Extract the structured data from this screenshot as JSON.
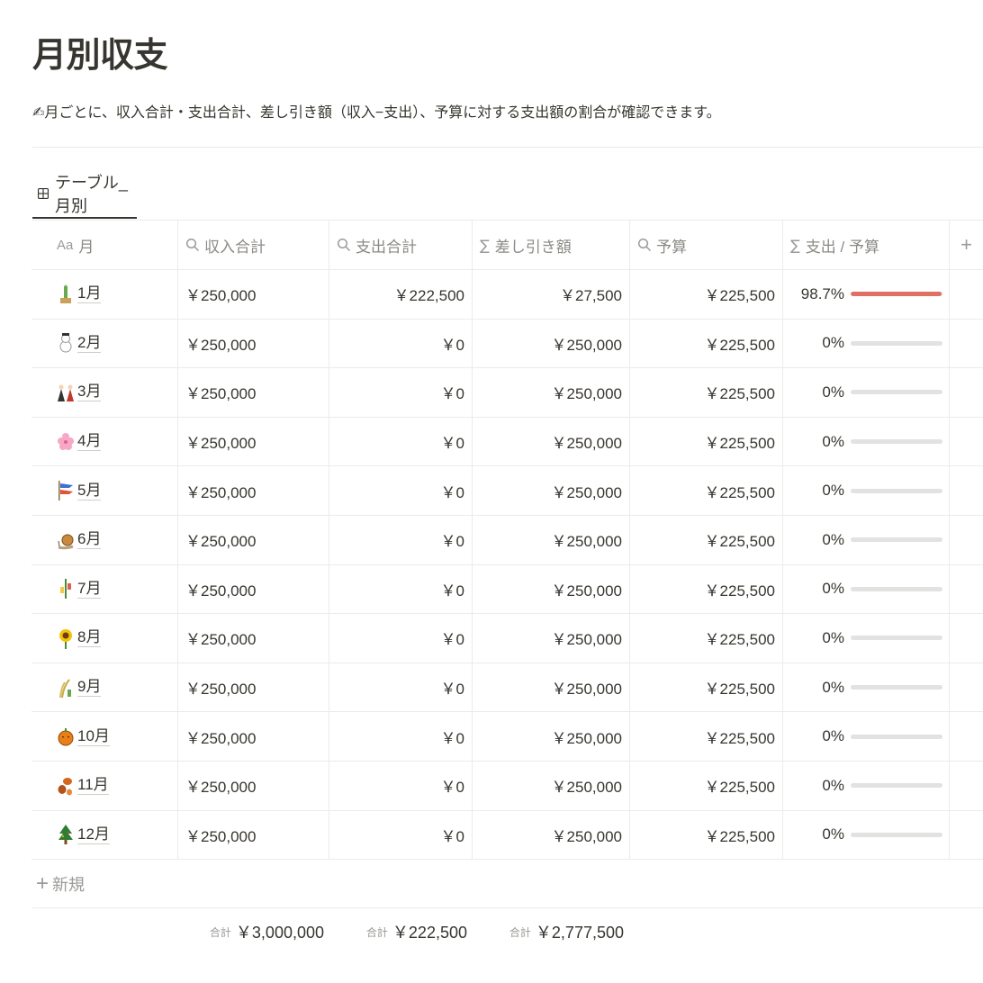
{
  "page": {
    "title": "月別収支",
    "description": "月ごとに、収入合計・支出合計、差し引き額（収入−支出）、予算に対する支出額の割合が確認できます。",
    "description_icon": "writing-hand-icon"
  },
  "view": {
    "tab_label": "テーブル_月別",
    "tab_icon": "table-icon"
  },
  "columns": [
    {
      "label": "月",
      "icon": "title-aa-icon"
    },
    {
      "label": "収入合計",
      "icon": "search-icon"
    },
    {
      "label": "支出合計",
      "icon": "search-icon"
    },
    {
      "label": "差し引き額",
      "icon": "sigma-icon"
    },
    {
      "label": "予算",
      "icon": "search-icon"
    },
    {
      "label": "支出 / 予算",
      "icon": "sigma-icon"
    }
  ],
  "add_column_label": "+",
  "rows": [
    {
      "month": "1月",
      "icon": "kadomatsu-icon",
      "income": "￥250,000",
      "expense": "￥222,500",
      "diff": "￥27,500",
      "budget": "￥225,500",
      "ratio_text": "98.7%",
      "ratio": 0.987
    },
    {
      "month": "2月",
      "icon": "snowman-icon",
      "income": "￥250,000",
      "expense": "￥0",
      "diff": "￥250,000",
      "budget": "￥225,500",
      "ratio_text": "0%",
      "ratio": 0
    },
    {
      "month": "3月",
      "icon": "hina-dolls-icon",
      "income": "￥250,000",
      "expense": "￥0",
      "diff": "￥250,000",
      "budget": "￥225,500",
      "ratio_text": "0%",
      "ratio": 0
    },
    {
      "month": "4月",
      "icon": "cherry-blossom-icon",
      "income": "￥250,000",
      "expense": "￥0",
      "diff": "￥250,000",
      "budget": "￥225,500",
      "ratio_text": "0%",
      "ratio": 0
    },
    {
      "month": "5月",
      "icon": "carp-streamer-icon",
      "income": "￥250,000",
      "expense": "￥0",
      "diff": "￥250,000",
      "budget": "￥225,500",
      "ratio_text": "0%",
      "ratio": 0
    },
    {
      "month": "6月",
      "icon": "snail-icon",
      "income": "￥250,000",
      "expense": "￥0",
      "diff": "￥250,000",
      "budget": "￥225,500",
      "ratio_text": "0%",
      "ratio": 0
    },
    {
      "month": "7月",
      "icon": "tanabata-tree-icon",
      "income": "￥250,000",
      "expense": "￥0",
      "diff": "￥250,000",
      "budget": "￥225,500",
      "ratio_text": "0%",
      "ratio": 0
    },
    {
      "month": "8月",
      "icon": "sunflower-icon",
      "income": "￥250,000",
      "expense": "￥0",
      "diff": "￥250,000",
      "budget": "￥225,500",
      "ratio_text": "0%",
      "ratio": 0
    },
    {
      "month": "9月",
      "icon": "rice-ear-icon",
      "income": "￥250,000",
      "expense": "￥0",
      "diff": "￥250,000",
      "budget": "￥225,500",
      "ratio_text": "0%",
      "ratio": 0
    },
    {
      "month": "10月",
      "icon": "pumpkin-icon",
      "income": "￥250,000",
      "expense": "￥0",
      "diff": "￥250,000",
      "budget": "￥225,500",
      "ratio_text": "0%",
      "ratio": 0
    },
    {
      "month": "11月",
      "icon": "fallen-leaf-icon",
      "income": "￥250,000",
      "expense": "￥0",
      "diff": "￥250,000",
      "budget": "￥225,500",
      "ratio_text": "0%",
      "ratio": 0
    },
    {
      "month": "12月",
      "icon": "christmas-tree-icon",
      "income": "￥250,000",
      "expense": "￥0",
      "diff": "￥250,000",
      "budget": "￥225,500",
      "ratio_text": "0%",
      "ratio": 0
    }
  ],
  "new_row_label": "新規",
  "footer": {
    "label": "合計",
    "income_total": "￥3,000,000",
    "expense_total": "￥222,500",
    "diff_total": "￥2,777,500"
  },
  "colors": {
    "text": "#37352f",
    "muted": "#9b9a97",
    "bar_fill": "#e07065",
    "bar_track": "#e2e2e0",
    "grid": "#ebebea"
  }
}
